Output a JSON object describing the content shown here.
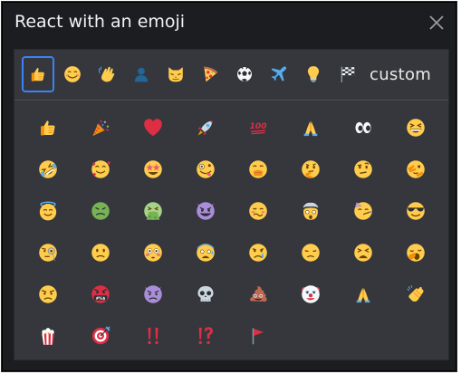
{
  "dialog": {
    "title": "React with an emoji",
    "close_icon": "close-icon"
  },
  "categories": [
    {
      "name": "thumbs-up",
      "icon": "thumbs-up-icon",
      "selected": true
    },
    {
      "name": "smileys",
      "icon": "smiley-icon",
      "selected": false
    },
    {
      "name": "people",
      "icon": "waving-hand-icon",
      "selected": false
    },
    {
      "name": "person",
      "icon": "person-silhouette-icon",
      "selected": false
    },
    {
      "name": "animals",
      "icon": "cat-icon",
      "selected": false
    },
    {
      "name": "food",
      "icon": "pizza-icon",
      "selected": false
    },
    {
      "name": "activities",
      "icon": "soccer-ball-icon",
      "selected": false
    },
    {
      "name": "travel",
      "icon": "airplane-icon",
      "selected": false
    },
    {
      "name": "objects",
      "icon": "light-bulb-icon",
      "selected": false
    },
    {
      "name": "flags",
      "icon": "checkered-flag-icon",
      "selected": false
    }
  ],
  "custom_tab_label": "custom",
  "emojis": [
    "thumbs-up",
    "party-popper",
    "red-heart",
    "rocket",
    "hundred-points",
    "folded-hands",
    "eyes",
    "grinning-squinting-face",
    "rolling-on-floor-laughing",
    "smiling-face-with-hearts",
    "star-struck",
    "zany-face",
    "face-with-hand-over-mouth",
    "thinking-face",
    "face-with-raised-eyebrow",
    "face-with-peeking-eye",
    "smiling-face-with-halo",
    "nauseated-face",
    "face-vomiting",
    "smiling-face-with-horns",
    "woozy-face",
    "exploding-head",
    "partying-face",
    "smiling-face-with-sunglasses",
    "face-with-monocle",
    "slightly-frowning-face",
    "flushed-face",
    "anxious-face-with-sweat",
    "crying-face",
    "disappointed-face",
    "weary-face",
    "yawning-face",
    "angry-face",
    "face-with-symbols-on-mouth",
    "angry-face-with-horns",
    "skull",
    "pile-of-poo",
    "clown-face",
    "folded-hands",
    "clapping-hands",
    "popcorn",
    "direct-hit",
    "double-exclamation-mark",
    "exclamation-question-mark",
    "triangular-flag"
  ]
}
